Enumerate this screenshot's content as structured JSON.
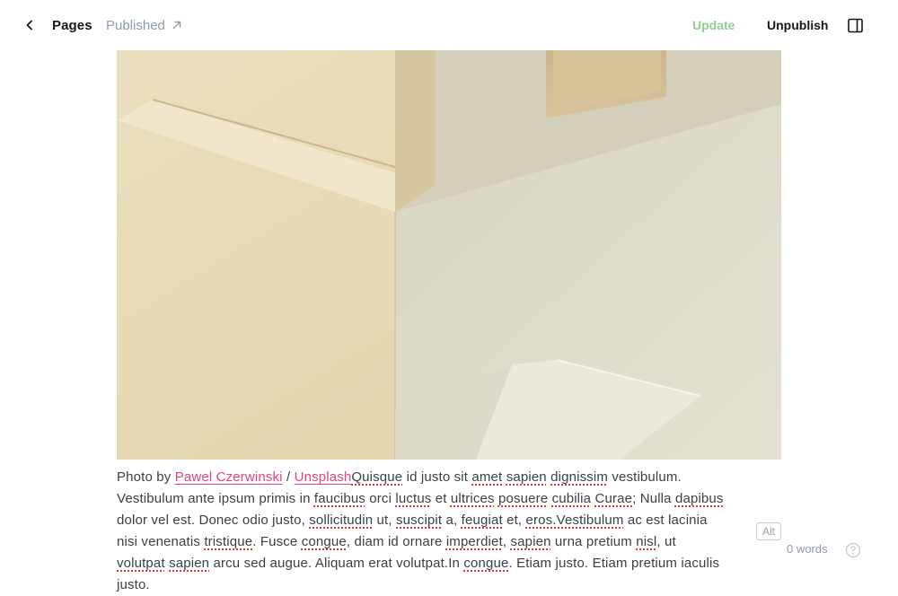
{
  "header": {
    "back_label": "Pages",
    "status_label": "Published",
    "update_label": "Update",
    "unpublish_label": "Unpublish"
  },
  "colors": {
    "update_disabled": "#8fd08f",
    "link": "#e0457b",
    "muted": "#8e9cac"
  },
  "caption": {
    "prefix": "Photo by ",
    "author": "Pawel Czerwinski",
    "separator": " / ",
    "source": "Unsplash"
  },
  "body": {
    "segments": [
      {
        "t": "Quisque",
        "s": true
      },
      {
        "t": " id justo sit "
      },
      {
        "t": "amet",
        "s": true
      },
      {
        "t": " "
      },
      {
        "t": "sapien",
        "s": true
      },
      {
        "t": " "
      },
      {
        "t": "dignissim",
        "s": true
      },
      {
        "t": " vestibulum. Vestibulum ante ipsum primis in "
      },
      {
        "t": "faucibus",
        "s": true
      },
      {
        "t": " orci "
      },
      {
        "t": "luctus",
        "s": true
      },
      {
        "t": " et "
      },
      {
        "t": "ultrices",
        "s": true
      },
      {
        "t": " "
      },
      {
        "t": "posuere",
        "s": true
      },
      {
        "t": " "
      },
      {
        "t": "cubilia",
        "s": true
      },
      {
        "t": " "
      },
      {
        "t": "Curae",
        "s": true
      },
      {
        "t": "; Nulla "
      },
      {
        "t": "dapibus",
        "s": true
      },
      {
        "t": " dolor vel est. Donec odio justo, "
      },
      {
        "t": "sollicitudin",
        "s": true
      },
      {
        "t": " ut, "
      },
      {
        "t": "suscipit",
        "s": true
      },
      {
        "t": " a, "
      },
      {
        "t": "feugiat",
        "s": true
      },
      {
        "t": " et, "
      },
      {
        "t": "eros.Vestibulum",
        "s": true
      },
      {
        "t": " ac est lacinia nisi venenatis "
      },
      {
        "t": "tristique",
        "s": true
      },
      {
        "t": ". Fusce "
      },
      {
        "t": "congue",
        "s": true
      },
      {
        "t": ", diam id ornare "
      },
      {
        "t": "imperdiet",
        "s": true
      },
      {
        "t": ", "
      },
      {
        "t": "sapien",
        "s": true
      },
      {
        "t": " urna pretium "
      },
      {
        "t": "nisl",
        "s": true
      },
      {
        "t": ", ut "
      },
      {
        "t": "volutpat",
        "s": true
      },
      {
        "t": " "
      },
      {
        "t": "sapien",
        "s": true
      },
      {
        "t": " arcu sed augue. Aliquam erat volutpat.In "
      },
      {
        "t": "congue",
        "s": true
      },
      {
        "t": ". Etiam justo. Etiam pretium iaculis justo."
      }
    ]
  },
  "image": {
    "alt_button_label": "Alt"
  },
  "footer": {
    "word_count": "0 words"
  },
  "icons": {
    "back": "chevron-left-icon",
    "external": "arrow-up-right-icon",
    "sidebar": "sidebar-toggle-icon",
    "help": "question-circle-icon"
  }
}
